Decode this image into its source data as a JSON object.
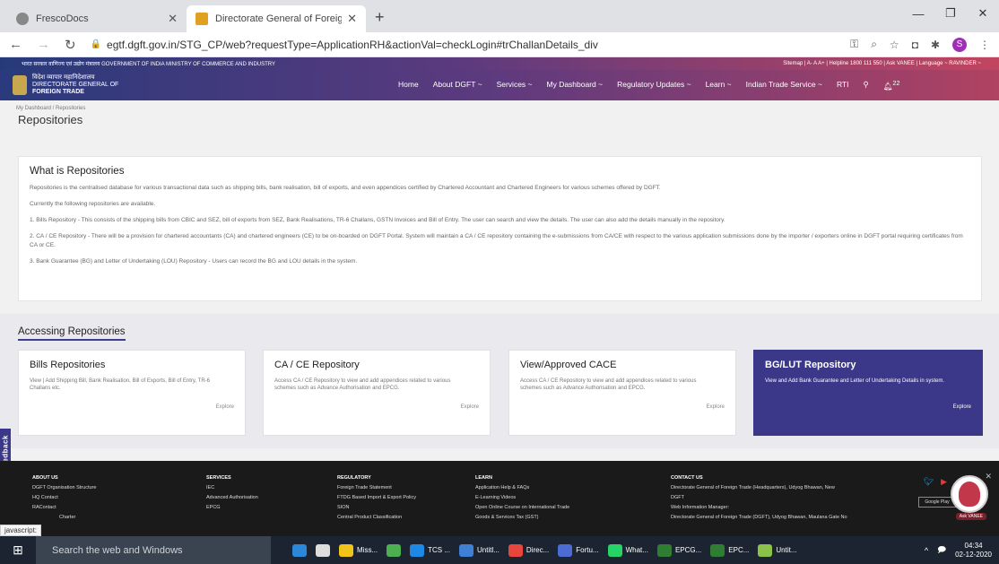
{
  "browser": {
    "tabs": [
      {
        "title": "FrescoDocs",
        "icon": "fresco-icon",
        "active": false
      },
      {
        "title": "Directorate General of Foreign Tr",
        "icon": "dgft-icon",
        "active": true
      }
    ],
    "new_tab": "+",
    "url": "egtf.dgft.gov.in/STG_CP/web?requestType=ApplicationRH&actionVal=checkLogin#trChallanDetails_div",
    "profile_initial": "S"
  },
  "site": {
    "topstrip_left": "भारत सरकार  वाणिज्य एवं उद्योग मंत्रालय  GOVERNMENT OF INDIA  MINISTRY OF COMMERCE AND INDUSTRY",
    "topstrip_right": "Sitemap | A-  A  A+ | Helpline 1800 111 550 | Ask VANEE | Language ~  RAVINDER ~",
    "logo_hindi": "विदेश व्यापार महानिदेशालय",
    "logo_line1": "DIRECTORATE GENERAL OF",
    "logo_line2": "FOREIGN TRADE",
    "nav": [
      "Home",
      "About DGFT ~",
      "Services ~",
      "My Dashboard ~",
      "Regulatory Updates ~",
      "Learn ~",
      "Indian Trade Service ~",
      "RTI"
    ],
    "notif_count": "22"
  },
  "page": {
    "breadcrumb": "My Dashboard / Repositories",
    "title": "Repositories",
    "what_heading": "What is Repositories",
    "para1": "Repositories is the centralised database for various transactional data such as shipping bills, bank realisation, bill of exports, and even appendices certified by Chartered Accountant and Chartered Engineers for various schemes offered by DGFT.",
    "para2": "Currently the following repositories are available.",
    "para3": "1. Bills Repository - This consists of the shipping bills from CBIC and SEZ, bill of exports from SEZ, Bank Realisations, TR-6 Challans, GSTN Invoices and Bill of Entry. The user can search and view the details. The user can also add the details manually in the repository.",
    "para4": "2. CA / CE Repository - There will be a provision for chartered accountants (CA) and chartered engineers (CE) to be on-boarded on DGFT Portal. System will maintain a CA / CE repository containing the e-submissions from CA/CE with respect to the various application submissions done by the importer / exporters online in DGFT portal requiring certificates from CA or CE.",
    "para5": "3. Bank Guarantee (BG) and Letter of Undertaking (LOU) Repository - Users can record the BG and LOU details in the system.",
    "accessing_heading": "Accessing Repositories",
    "cards": [
      {
        "title": "Bills Repositories",
        "desc": "View | Add Shipping Bill, Bank Realisation, Bill of Exports, Bill of Entry, TR-6 Challans etc.",
        "link": "Explore"
      },
      {
        "title": "CA / CE Repository",
        "desc": "Access CA / CE Repository to view and add appendices related to various schemes such as Advance Authorisation and EPCG.",
        "link": "Explore"
      },
      {
        "title": "View/Approved CACE",
        "desc": "Access CA / CE Repository to view and add appendices related to various schemes such as Advance Authorisation and EPCG.",
        "link": "Explore"
      },
      {
        "title": "BG/LUT Repository",
        "desc": "View and Add Bank Guarantee and Letter of Undertaking Details in system.",
        "link": "Explore"
      }
    ],
    "feedback": "Feedback"
  },
  "footer": {
    "cols": [
      {
        "head": "ABOUT US",
        "items": [
          "DGFT Organisation Structure",
          "HQ Contact",
          "RAContact",
          "Charter"
        ]
      },
      {
        "head": "SERVICES",
        "items": [
          "IEC",
          "Advanced Authorisation",
          "EPCG"
        ]
      },
      {
        "head": "REGULATORY",
        "items": [
          "Foreign Trade Statement",
          "FTDG Based Import & Export Policy",
          "SION",
          "Central Product Classification"
        ]
      },
      {
        "head": "LEARN",
        "items": [
          "Application Help & FAQs",
          "E-Learning Videos",
          "Open Online Course on International Trade",
          "Goods & Services Tax (GST)"
        ]
      },
      {
        "head": "CONTACT US",
        "items": [
          "Directorate General of Foreign Trade (Headquarters), Udyog Bhawan, New",
          "DGFT",
          "Web Information Manager:",
          "Directorate General of Foreign Trade (DGFT), Udyog Bhawan, Maulana Gate No"
        ]
      }
    ],
    "store": "Google Play",
    "avatar_name": "Ask VANEE",
    "status_js": "javascript:"
  },
  "taskbar": {
    "search": "Search the web and Windows",
    "apps": [
      {
        "label": "",
        "color": "#2b88d8",
        "icon": "task-view-icon"
      },
      {
        "label": "",
        "color": "#ddd",
        "icon": "store-icon"
      },
      {
        "label": "Miss...",
        "color": "#f0c419",
        "icon": "folder-icon"
      },
      {
        "label": "",
        "color": "#4caf50",
        "icon": "people-icon"
      },
      {
        "label": "TCS ...",
        "color": "#1e88e5",
        "icon": "ie-icon"
      },
      {
        "label": "Untitl...",
        "color": "#3f7fd6",
        "icon": "paint-icon"
      },
      {
        "label": "Direc...",
        "color": "#e8453c",
        "icon": "chrome-icon"
      },
      {
        "label": "Fortu...",
        "color": "#4a6cd4",
        "icon": "app-icon"
      },
      {
        "label": "What...",
        "color": "#25d366",
        "icon": "whatsapp-icon"
      },
      {
        "label": "EPCG...",
        "color": "#2e7d32",
        "icon": "excel-icon"
      },
      {
        "label": "EPC...",
        "color": "#2e7d32",
        "icon": "excel-icon"
      },
      {
        "label": "Untit...",
        "color": "#8bc34a",
        "icon": "paint-icon"
      }
    ],
    "time": "04:34",
    "date": "02-12-2020"
  }
}
